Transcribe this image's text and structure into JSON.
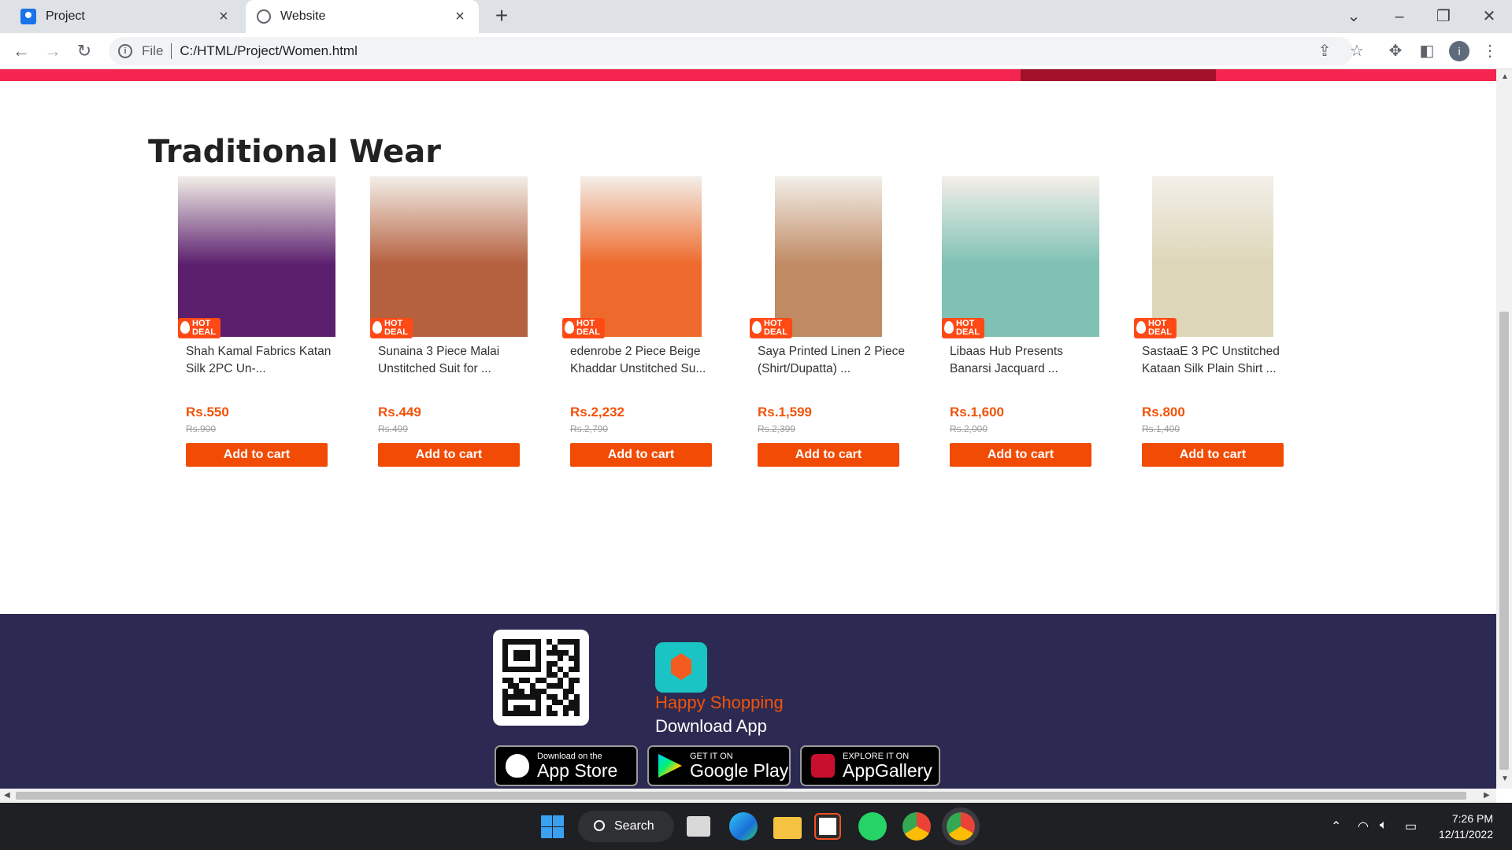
{
  "browser": {
    "tabs": [
      {
        "title": "Project",
        "active": false
      },
      {
        "title": "Website",
        "active": true
      }
    ],
    "new_tab_label": "+",
    "address": {
      "scheme": "File",
      "url": "C:/HTML/Project/Women.html"
    }
  },
  "page": {
    "section_title": "Traditional Wear",
    "badge_text": "HOT DEAL",
    "products": [
      {
        "name": "Shah Kamal Fabrics Katan Silk 2PC Un-...",
        "price": "Rs.550",
        "old_price": "Rs.900",
        "button": "Add to cart",
        "swatch": "#5b1f6e"
      },
      {
        "name": "Sunaina 3 Piece Malai Unstitched Suit for ...",
        "price": "Rs.449",
        "old_price": "Rs.499",
        "button": "Add to cart",
        "swatch": "#b5603e"
      },
      {
        "name": "edenrobe 2 Piece Beige Khaddar Unstitched Su...",
        "price": "Rs.2,232",
        "old_price": "Rs.2,790",
        "button": "Add to cart",
        "swatch": "#ee6a2c"
      },
      {
        "name": "Saya Printed Linen 2 Piece (Shirt/Dupatta) ...",
        "price": "Rs.1,599",
        "old_price": "Rs.2,399",
        "button": "Add to cart",
        "swatch": "#c08a63"
      },
      {
        "name": "Libaas Hub Presents Banarsi Jacquard ...",
        "price": "Rs.1,600",
        "old_price": "Rs.2,000",
        "button": "Add to cart",
        "swatch": "#7fc1b4"
      },
      {
        "name": "SastaaE 3 PC Unstitched Kataan Silk Plain Shirt ...",
        "price": "Rs.800",
        "old_price": "Rs.1,400",
        "button": "Add to cart",
        "swatch": "#ddd6b8"
      }
    ]
  },
  "footer": {
    "tagline": "Happy Shopping",
    "download": "Download App",
    "stores": [
      {
        "small": "Download on the",
        "big": "App Store"
      },
      {
        "small": "GET IT ON",
        "big": "Google Play"
      },
      {
        "small": "EXPLORE IT ON",
        "big": "AppGallery"
      }
    ]
  },
  "taskbar": {
    "search_label": "Search",
    "time": "7:26 PM",
    "date": "12/11/2022"
  },
  "colors": {
    "accent": "#f24b05",
    "footer_bg": "#2c2a52",
    "banner": "#f4254f"
  }
}
